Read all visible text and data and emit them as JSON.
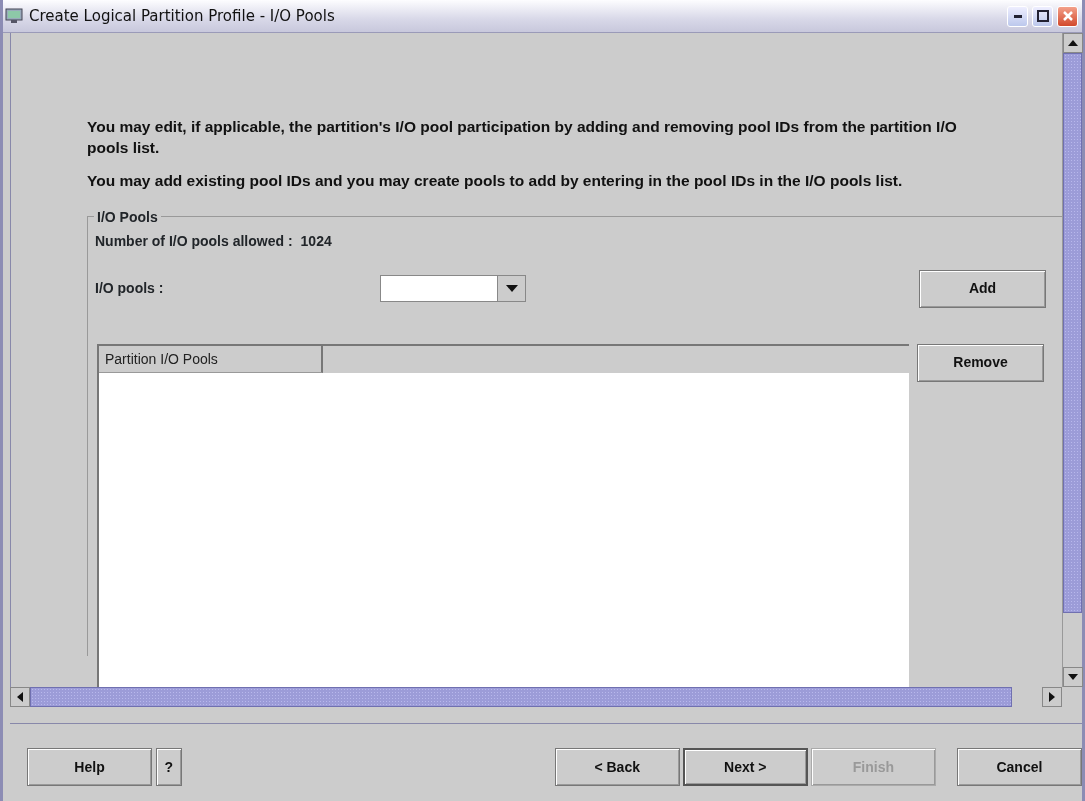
{
  "window": {
    "title": "Create Logical Partition Profile - I/O Pools"
  },
  "paragraphs": [
    "You may edit, if applicable, the partition's I/O pool participation by adding and removing pool IDs from the partition I/O pools list.",
    "You may add existing pool IDs and you may create pools to add by entering in the pool IDs in the I/O pools list."
  ],
  "group": {
    "title": "I/O Pools",
    "allowed_label": "Number of I/O pools allowed :",
    "allowed_value": "1024",
    "pools_label": "I/O pools :",
    "add_button": "Add",
    "table": {
      "columns": [
        "Partition I/O Pools"
      ]
    },
    "remove_button": "Remove"
  },
  "buttons": [
    {
      "label": "Help",
      "kind": "button",
      "default": false,
      "disabled": false
    },
    {
      "label": "?",
      "kind": "icon",
      "default": false,
      "disabled": false
    },
    {
      "label": "< Back",
      "kind": "button",
      "default": false,
      "disabled": false
    },
    {
      "label": "Next >",
      "kind": "button",
      "default": true,
      "disabled": false
    },
    {
      "label": "Finish",
      "kind": "button",
      "default": false,
      "disabled": true
    },
    {
      "label": "Cancel",
      "kind": "button",
      "default": false,
      "disabled": false
    }
  ]
}
